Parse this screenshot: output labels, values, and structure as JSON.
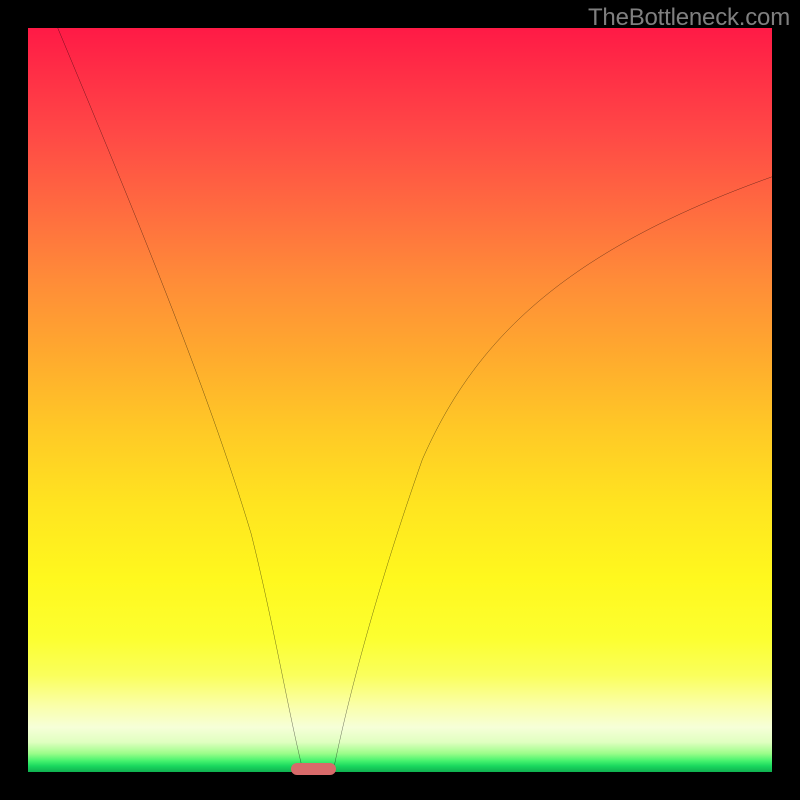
{
  "watermark": "TheBottleneck.com",
  "colors": {
    "frame": "#000000",
    "gradient_top": "#ff1a46",
    "gradient_bottom": "#0fb050",
    "curve": "#000000",
    "marker": "#d86a6a",
    "watermark_text": "#7f7f7f"
  },
  "chart_data": {
    "type": "line",
    "title": "",
    "xlabel": "",
    "ylabel": "",
    "xlim": [
      0,
      100
    ],
    "ylim": [
      0,
      100
    ],
    "grid": false,
    "legend": false,
    "series": [
      {
        "name": "left-branch",
        "x": [
          4,
          8,
          12,
          16,
          20,
          24,
          28,
          30,
          32,
          34,
          35,
          36,
          37
        ],
        "y": [
          100,
          88,
          76,
          64,
          52,
          40,
          27,
          20,
          13,
          6,
          3,
          1,
          0
        ]
      },
      {
        "name": "right-branch",
        "x": [
          41,
          42,
          44,
          47,
          50,
          55,
          60,
          65,
          70,
          75,
          80,
          85,
          90,
          95,
          100
        ],
        "y": [
          0,
          2,
          8,
          18,
          27,
          38,
          47,
          54,
          60,
          65,
          69,
          72.5,
          75.5,
          78,
          80
        ]
      }
    ],
    "optimum_marker": {
      "x_start": 35.5,
      "x_end": 41.5,
      "y": 0
    },
    "notes": "V-shaped bottleneck curve over vertical traffic-light gradient (red high bottleneck at top, green optimal at bottom). Y values are read against the gradient where 0=bottom(green) and 100=top(red); no numeric axes are shown in the image, scale is normalized."
  }
}
